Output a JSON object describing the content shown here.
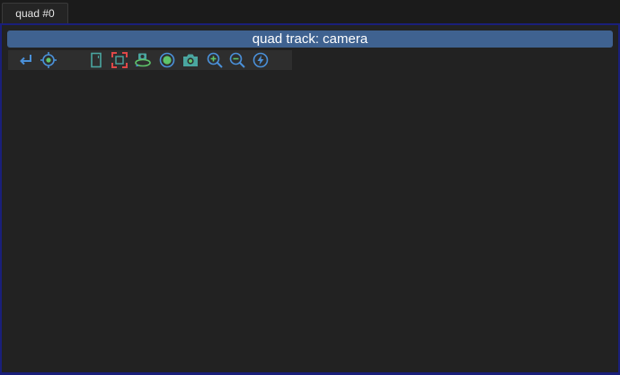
{
  "tabs": [
    {
      "label": "quad #0",
      "active": true
    }
  ],
  "panel": {
    "title": "quad track: camera"
  },
  "toolbar": {
    "buttons": [
      {
        "icon": "return-arrow-icon"
      },
      {
        "icon": "crosshair-target-icon"
      },
      {
        "icon": "frame-rectangle-icon"
      },
      {
        "icon": "fit-selection-brackets-icon"
      },
      {
        "icon": "orbit-camera-icon"
      },
      {
        "icon": "record-circle-icon"
      },
      {
        "icon": "camera-snapshot-icon"
      },
      {
        "icon": "zoom-in-icon"
      },
      {
        "icon": "zoom-out-icon"
      },
      {
        "icon": "lightning-icon"
      }
    ]
  },
  "colors": {
    "panel_border": "#1a1f7a",
    "title_bar": "#3f6290",
    "icon_blue": "#4a90d9",
    "icon_green": "#5ec46a",
    "icon_teal": "#4aa6a0",
    "icon_red": "#e04848"
  }
}
